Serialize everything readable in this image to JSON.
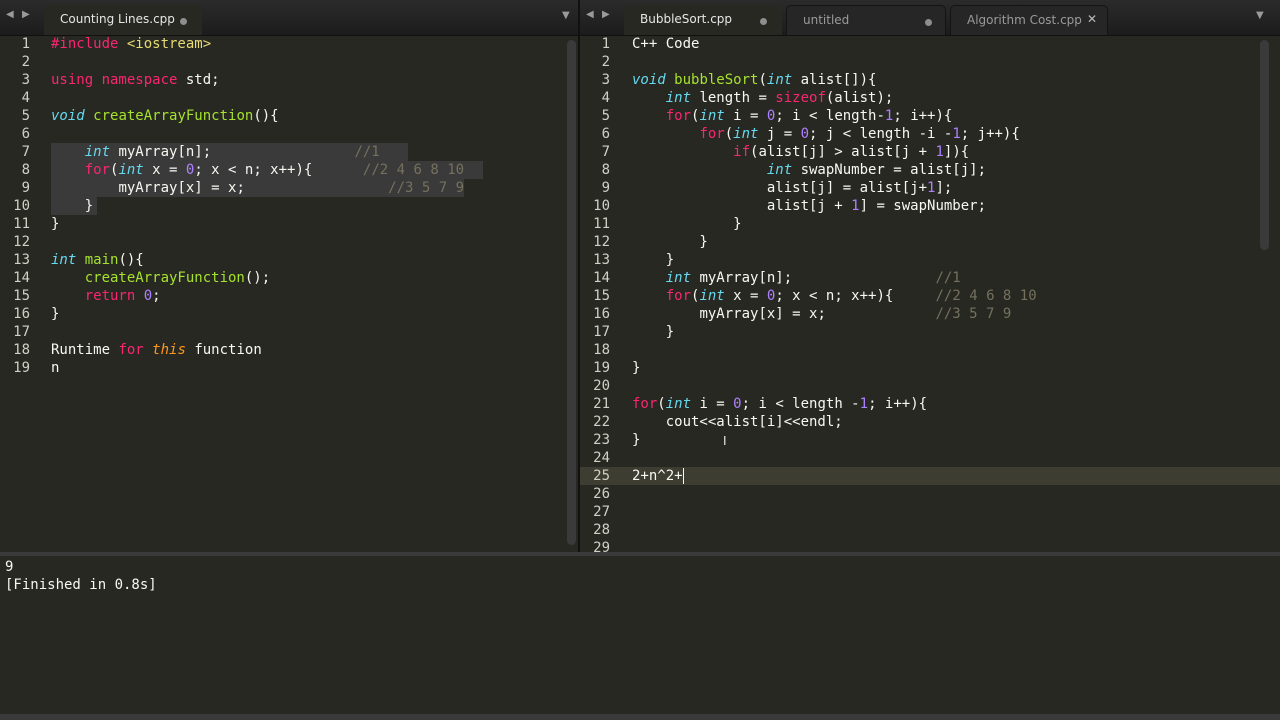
{
  "left": {
    "tabs": [
      {
        "label": "Counting Lines.cpp"
      }
    ],
    "lines": [
      [
        {
          "t": "#include ",
          "c": "k"
        },
        {
          "t": "<iostream>",
          "c": "s"
        }
      ],
      [],
      [
        {
          "t": "using ",
          "c": "k"
        },
        {
          "t": "namespace ",
          "c": "k"
        },
        {
          "t": "std;",
          "c": ""
        }
      ],
      [],
      [
        {
          "t": "void ",
          "c": "ty"
        },
        {
          "t": "createArrayFunction",
          "c": "fn"
        },
        {
          "t": "(){",
          "c": ""
        }
      ],
      [],
      [
        {
          "t": "    ",
          "c": ""
        },
        {
          "t": "int ",
          "c": "ty"
        },
        {
          "t": "myArray[n];",
          "c": ""
        },
        {
          "t": "                 ",
          "c": ""
        },
        {
          "t": "//1",
          "c": "c"
        }
      ],
      [
        {
          "t": "    ",
          "c": ""
        },
        {
          "t": "for",
          "c": "k"
        },
        {
          "t": "(",
          "c": ""
        },
        {
          "t": "int ",
          "c": "ty"
        },
        {
          "t": "x = ",
          "c": ""
        },
        {
          "t": "0",
          "c": "n"
        },
        {
          "t": "; x < n; x++){",
          "c": ""
        },
        {
          "t": "      ",
          "c": ""
        },
        {
          "t": "//2 4 6 8 10",
          "c": "c"
        }
      ],
      [
        {
          "t": "        ",
          "c": ""
        },
        {
          "t": "myArray[x] = x;",
          "c": ""
        },
        {
          "t": "                 ",
          "c": ""
        },
        {
          "t": "//3 5 7 9",
          "c": "c"
        }
      ],
      [
        {
          "t": "    }",
          "c": ""
        }
      ],
      [
        {
          "t": "}",
          "c": ""
        }
      ],
      [],
      [
        {
          "t": "int ",
          "c": "ty"
        },
        {
          "t": "main",
          "c": "fn"
        },
        {
          "t": "(){",
          "c": ""
        }
      ],
      [
        {
          "t": "    ",
          "c": ""
        },
        {
          "t": "createArrayFunction",
          "c": "fn"
        },
        {
          "t": "();",
          "c": ""
        }
      ],
      [
        {
          "t": "    ",
          "c": ""
        },
        {
          "t": "return ",
          "c": "k"
        },
        {
          "t": "0",
          "c": "n"
        },
        {
          "t": ";",
          "c": ""
        }
      ],
      [
        {
          "t": "}",
          "c": ""
        }
      ],
      [],
      [
        {
          "t": "Runtime ",
          "c": ""
        },
        {
          "t": "for ",
          "c": "k"
        },
        {
          "t": "this ",
          "c": "p"
        },
        {
          "t": "function",
          "c": ""
        }
      ],
      [
        {
          "t": "n",
          "c": ""
        }
      ]
    ]
  },
  "right": {
    "tabs": [
      {
        "label": "BubbleSort.cpp"
      },
      {
        "label": "untitled"
      },
      {
        "label": "Algorithm Cost.cpp"
      }
    ],
    "lines": [
      [
        {
          "t": "C++ Code",
          "c": ""
        }
      ],
      [],
      [
        {
          "t": "void ",
          "c": "ty"
        },
        {
          "t": "bubbleSort",
          "c": "fn"
        },
        {
          "t": "(",
          "c": ""
        },
        {
          "t": "int ",
          "c": "ty"
        },
        {
          "t": "alist[]){",
          "c": ""
        }
      ],
      [
        {
          "t": "    ",
          "c": ""
        },
        {
          "t": "int ",
          "c": "ty"
        },
        {
          "t": "length = ",
          "c": ""
        },
        {
          "t": "sizeof",
          "c": "k"
        },
        {
          "t": "(alist);",
          "c": ""
        }
      ],
      [
        {
          "t": "    ",
          "c": ""
        },
        {
          "t": "for",
          "c": "k"
        },
        {
          "t": "(",
          "c": ""
        },
        {
          "t": "int ",
          "c": "ty"
        },
        {
          "t": "i = ",
          "c": ""
        },
        {
          "t": "0",
          "c": "n"
        },
        {
          "t": "; i < length-",
          "c": ""
        },
        {
          "t": "1",
          "c": "n"
        },
        {
          "t": "; i++){",
          "c": ""
        }
      ],
      [
        {
          "t": "        ",
          "c": ""
        },
        {
          "t": "for",
          "c": "k"
        },
        {
          "t": "(",
          "c": ""
        },
        {
          "t": "int ",
          "c": "ty"
        },
        {
          "t": "j = ",
          "c": ""
        },
        {
          "t": "0",
          "c": "n"
        },
        {
          "t": "; j < length -i -",
          "c": ""
        },
        {
          "t": "1",
          "c": "n"
        },
        {
          "t": "; j++){",
          "c": ""
        }
      ],
      [
        {
          "t": "            ",
          "c": ""
        },
        {
          "t": "if",
          "c": "k"
        },
        {
          "t": "(alist[j] > alist[j + ",
          "c": ""
        },
        {
          "t": "1",
          "c": "n"
        },
        {
          "t": "]){",
          "c": ""
        }
      ],
      [
        {
          "t": "                ",
          "c": ""
        },
        {
          "t": "int ",
          "c": "ty"
        },
        {
          "t": "swapNumber = alist[j];",
          "c": ""
        }
      ],
      [
        {
          "t": "                ",
          "c": ""
        },
        {
          "t": "alist[j] = alist[j+",
          "c": ""
        },
        {
          "t": "1",
          "c": "n"
        },
        {
          "t": "];",
          "c": ""
        }
      ],
      [
        {
          "t": "                ",
          "c": ""
        },
        {
          "t": "alist[j + ",
          "c": ""
        },
        {
          "t": "1",
          "c": "n"
        },
        {
          "t": "] = swapNumber;",
          "c": ""
        }
      ],
      [
        {
          "t": "            }",
          "c": ""
        }
      ],
      [
        {
          "t": "        }",
          "c": ""
        }
      ],
      [
        {
          "t": "    }",
          "c": ""
        }
      ],
      [
        {
          "t": "    ",
          "c": ""
        },
        {
          "t": "int ",
          "c": "ty"
        },
        {
          "t": "myArray[n];",
          "c": ""
        },
        {
          "t": "                 ",
          "c": ""
        },
        {
          "t": "//1",
          "c": "c"
        }
      ],
      [
        {
          "t": "    ",
          "c": ""
        },
        {
          "t": "for",
          "c": "k"
        },
        {
          "t": "(",
          "c": ""
        },
        {
          "t": "int ",
          "c": "ty"
        },
        {
          "t": "x = ",
          "c": ""
        },
        {
          "t": "0",
          "c": "n"
        },
        {
          "t": "; x < n; x++){",
          "c": ""
        },
        {
          "t": "     ",
          "c": ""
        },
        {
          "t": "//2 4 6 8 10",
          "c": "c"
        }
      ],
      [
        {
          "t": "        ",
          "c": ""
        },
        {
          "t": "myArray[x] = x;",
          "c": ""
        },
        {
          "t": "             ",
          "c": ""
        },
        {
          "t": "//3 5 7 9",
          "c": "c"
        }
      ],
      [
        {
          "t": "    }",
          "c": ""
        }
      ],
      [],
      [
        {
          "t": "}",
          "c": ""
        }
      ],
      [],
      [
        {
          "t": "for",
          "c": "k"
        },
        {
          "t": "(",
          "c": ""
        },
        {
          "t": "int ",
          "c": "ty"
        },
        {
          "t": "i = ",
          "c": ""
        },
        {
          "t": "0",
          "c": "n"
        },
        {
          "t": "; i < length -",
          "c": ""
        },
        {
          "t": "1",
          "c": "n"
        },
        {
          "t": "; i++){",
          "c": ""
        }
      ],
      [
        {
          "t": "    ",
          "c": ""
        },
        {
          "t": "cout<<alist[i]<<endl;",
          "c": ""
        }
      ],
      [
        {
          "t": "}",
          "c": ""
        }
      ],
      [],
      [
        {
          "t": "2+n^2+",
          "c": ""
        }
      ],
      [],
      [],
      [],
      []
    ]
  },
  "console": {
    "lines": [
      "9",
      "[Finished in 0.8s]"
    ]
  }
}
